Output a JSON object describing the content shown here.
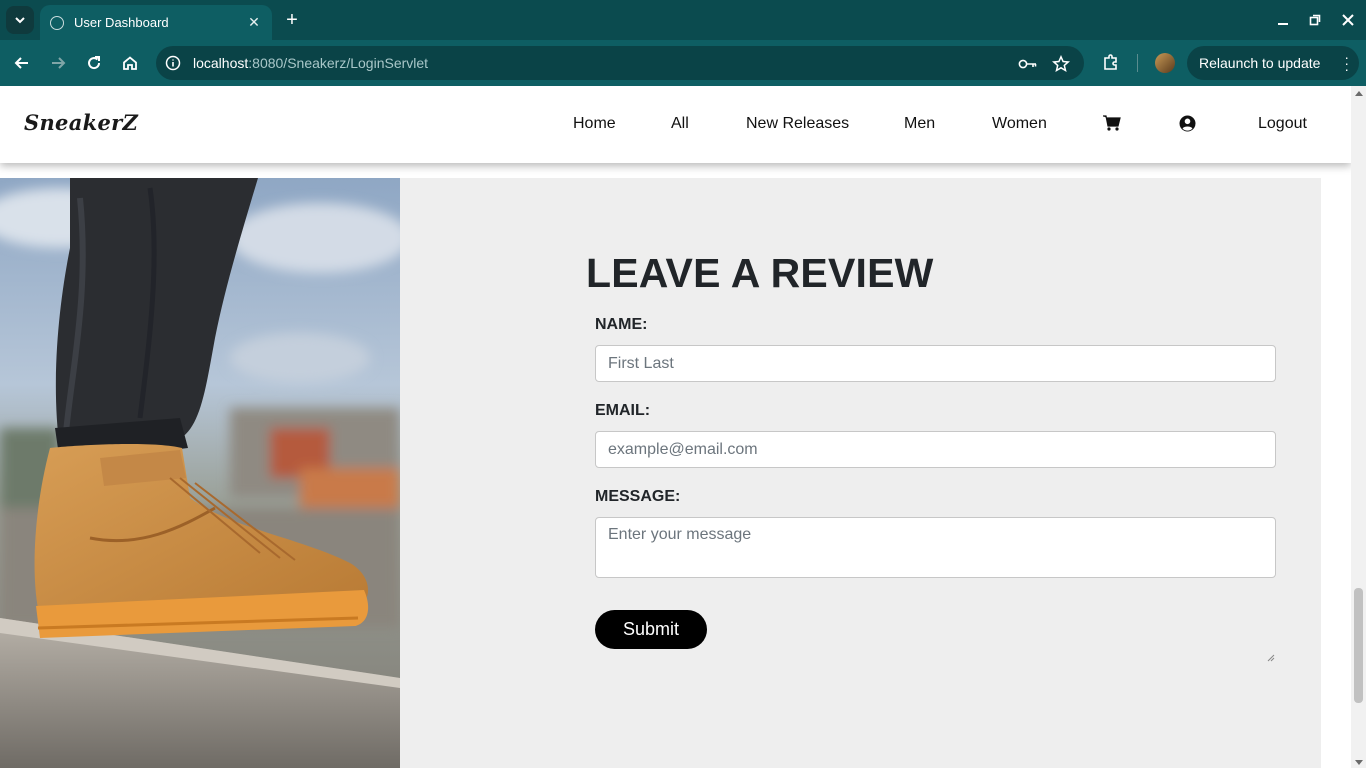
{
  "browser": {
    "tab_title": "User Dashboard",
    "url_host": "localhost",
    "url_path": ":8080/Sneakerz/LoginServlet",
    "relaunch_label": "Relaunch to update",
    "theme_color": "#0e5e63"
  },
  "site": {
    "logo": "SneakerZ",
    "nav": {
      "home": "Home",
      "all": "All",
      "new_releases": "New Releases",
      "men": "Men",
      "women": "Women",
      "logout": "Logout"
    },
    "icons": [
      "cart-icon",
      "user-circle-icon"
    ]
  },
  "review": {
    "title": "LEAVE A REVIEW",
    "name_label": "NAME:",
    "name_placeholder": "First Last",
    "email_label": "EMAIL:",
    "email_placeholder": "example@email.com",
    "message_label": "MESSAGE:",
    "message_placeholder": "Enter your message",
    "submit_label": "Submit",
    "panel_color": "#eeeeee",
    "button_color": "#000000"
  }
}
